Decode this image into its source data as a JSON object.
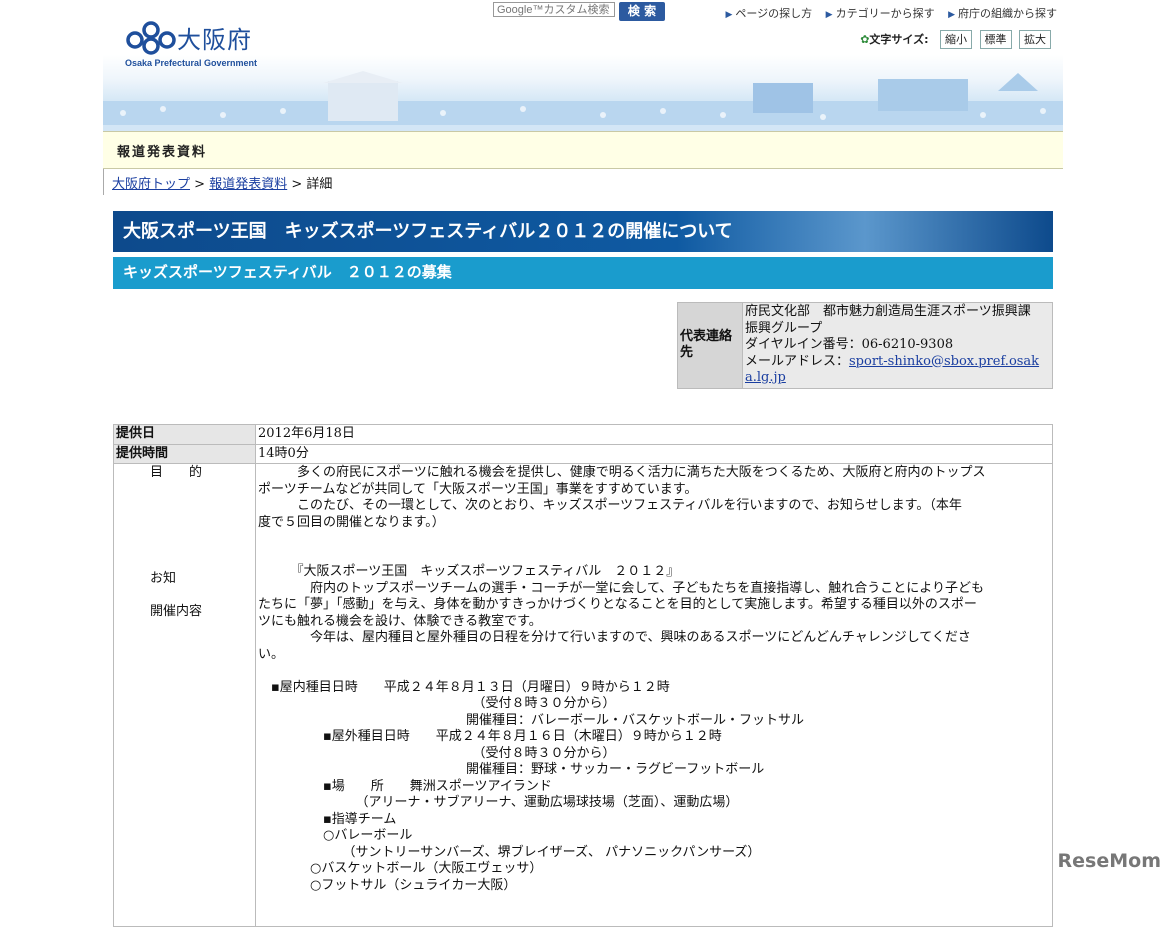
{
  "header": {
    "logo_name": "大阪府",
    "logo_en": "Osaka Prefectural Government",
    "search_placeholder": "Google™カスタム検索",
    "search_button": "検 索",
    "nav": [
      "ページの探し方",
      "カテゴリーから探す",
      "府庁の組織から探す"
    ],
    "font_size_label": "文字サイズ:",
    "font_size_buttons": [
      "縮小",
      "標準",
      "拡大"
    ]
  },
  "press_title": "報道発表資料",
  "breadcrumb": {
    "home": "大阪府トップ",
    "sep": ">",
    "section": "報道発表資料",
    "current": "詳細"
  },
  "title": "大阪スポーツ王国　キッズスポーツフェスティバル２０１２の開催について",
  "subtitle": "キッズスポーツフェスティバル　２０１２の募集",
  "contact": {
    "label": "代表連絡先",
    "dept": "府民文化部　都市魅力創造局生涯スポーツ振興課　振興グループ",
    "phone": "ダイヤルイン番号：06-6210-9308",
    "email_label": "メールアドレス：",
    "email": "sport-shinko@sbox.pref.osaka.lg.jp"
  },
  "details": {
    "date_label": "提供日",
    "date_value": "2012年6月18日",
    "time_label": "提供時間",
    "time_value": "14時0分",
    "section_labels": [
      "目　　的",
      "お知",
      "開催内容"
    ],
    "body": [
      "　　　多くの府民にスポーツに触れる機会を提供し、健康で明るく活力に満ちた大阪をつくるため、大阪府と府内のトップス",
      "ポーツチームなどが共同して「大阪スポーツ王国」事業をすすめています。",
      "　　　このたび、その一環として、次のとおり、キッズスポーツフェスティバルを行いますので、お知らせします。（本年",
      "度で５回目の開催となります。）",
      "",
      "",
      "　　　『大阪スポーツ王国　キッズスポーツフェスティバル　２０１２』",
      "　　　　府内のトップスポーツチームの選手・コーチが一堂に会して、子どもたちを直接指導し、触れ合うことにより子ども",
      "たちに「夢」「感動」を与え、身体を動かすきっかけづくりとなることを目的として実施します。希望する種目以外のスポー",
      "ツにも触れる機会を設け、体験できる教室です。",
      "　　　　今年は、屋内種目と屋外種目の日程を分けて行いますので、興味のあるスポーツにどんどんチャレンジしてくださ",
      "い。",
      "",
      "　▪屋内種目日時　　平成２４年８月１３日（月曜日）９時から１２時",
      "　　　　　　　　　　　　　　　　　（受付８時３０分から）",
      "　　　　　　　　　　　　　　　　開催種目：バレーボール・バスケットボール・フットサル",
      "　　　　　▪屋外種目日時　　平成２４年８月１６日（木曜日）９時から１２時",
      "　　　　　　　　　　　　　　　　　（受付８時３０分から）",
      "　　　　　　　　　　　　　　　　開催種目：野球・サッカー・ラグビーフットボール",
      "　　　　　▪場　　所　　舞洲スポーツアイランド",
      "　　　　　　　　（アリーナ・サブアリーナ、運動広場球技場（芝面）、運動広場）",
      "　　　　　▪指導チーム",
      "　　　　　○バレーボール",
      "　　　　　　　（サントリーサンバーズ、堺ブレイザーズ、 パナソニックパンサーズ）",
      "　　　　○バスケットボール（大阪エヴェッサ）",
      "　　　　○フットサル（シュライカー大阪）"
    ]
  },
  "watermark": "ReseMom"
}
